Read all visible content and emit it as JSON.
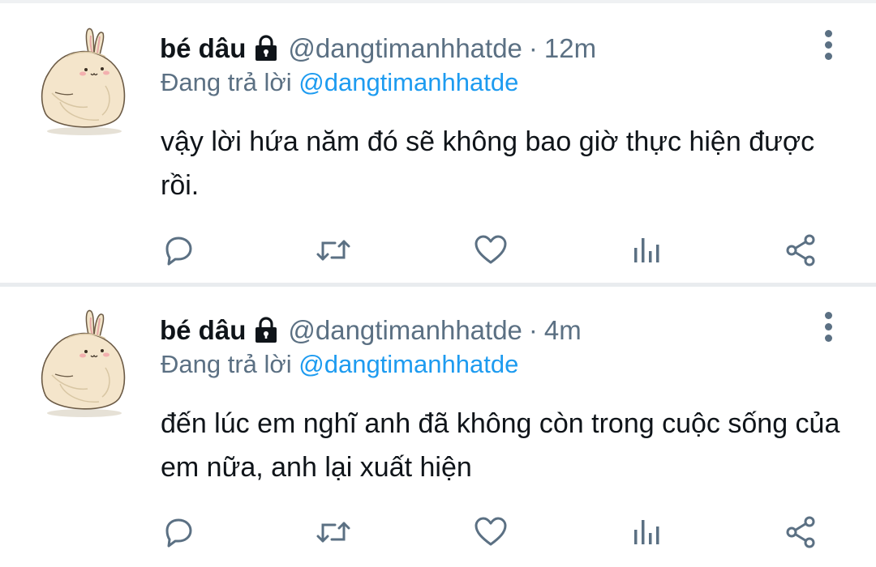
{
  "colors": {
    "text": "#0f1419",
    "secondary": "#5b7083",
    "link": "#1d9bf0",
    "divider": "#e9ecef"
  },
  "tweets": [
    {
      "display_name": "bé dâu",
      "handle": "@dangtimanhhatde",
      "separator": "·",
      "time": "12m",
      "replying_prefix": "Đang trả lời",
      "replying_to": "@dangtimanhhatde",
      "text": "vậy lời hứa năm đó sẽ không bao giờ thực hiện được rồi.",
      "icons": {
        "lock": "lock-icon",
        "more": "more-options-icon",
        "reply": "reply-icon",
        "retweet": "retweet-icon",
        "like": "like-icon",
        "stats": "analytics-icon",
        "share": "share-icon"
      }
    },
    {
      "display_name": "bé dâu",
      "handle": "@dangtimanhhatde",
      "separator": "·",
      "time": "4m",
      "replying_prefix": "Đang trả lời",
      "replying_to": "@dangtimanhhatde",
      "text": "đến lúc em nghĩ anh đã không còn trong cuộc sống của em nữa, anh lại xuất hiện",
      "icons": {
        "lock": "lock-icon",
        "more": "more-options-icon",
        "reply": "reply-icon",
        "retweet": "retweet-icon",
        "like": "like-icon",
        "stats": "analytics-icon",
        "share": "share-icon"
      }
    }
  ]
}
